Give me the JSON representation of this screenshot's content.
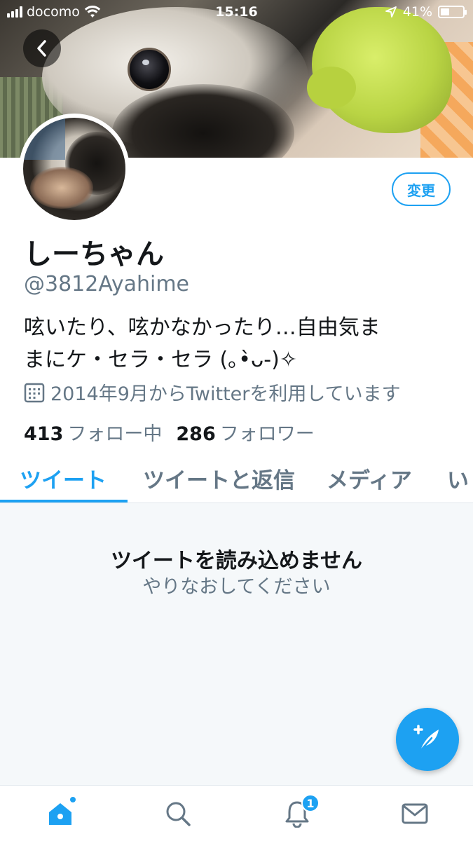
{
  "status_bar": {
    "carrier": "docomo",
    "time": "15:16",
    "battery_percent": "41%",
    "battery_level": 0.41
  },
  "profile": {
    "name": "しーちゃん",
    "handle": "@3812Ayahime",
    "bio_line1": "呟いたり、呟かなかったり…自由気ま",
    "bio_line2": "まにケ・セラ・セラ (｡•̀ᴗ-)✧",
    "joined": "2014年9月からTwitterを利用しています",
    "following_count": "413",
    "following_label": "フォロー中",
    "followers_count": "286",
    "followers_label": "フォロワー",
    "edit_button_label": "変更"
  },
  "tabs": [
    {
      "label": "ツイート",
      "active": true
    },
    {
      "label": "ツイートと返信",
      "active": false
    },
    {
      "label": "メディア",
      "active": false
    },
    {
      "label": "い",
      "active": false
    }
  ],
  "content": {
    "error_title": "ツイートを読み込めません",
    "error_subtitle": "やりなおしてください"
  },
  "bottom_nav": {
    "items": [
      {
        "icon": "home-icon",
        "active": true
      },
      {
        "icon": "search-icon",
        "active": false
      },
      {
        "icon": "bell-icon",
        "active": false,
        "badge": "1"
      },
      {
        "icon": "mail-icon",
        "active": false
      }
    ]
  },
  "colors": {
    "accent": "#1da1f2",
    "text_primary": "#14171a",
    "text_secondary": "#657786",
    "content_bg": "#f5f8fa"
  }
}
